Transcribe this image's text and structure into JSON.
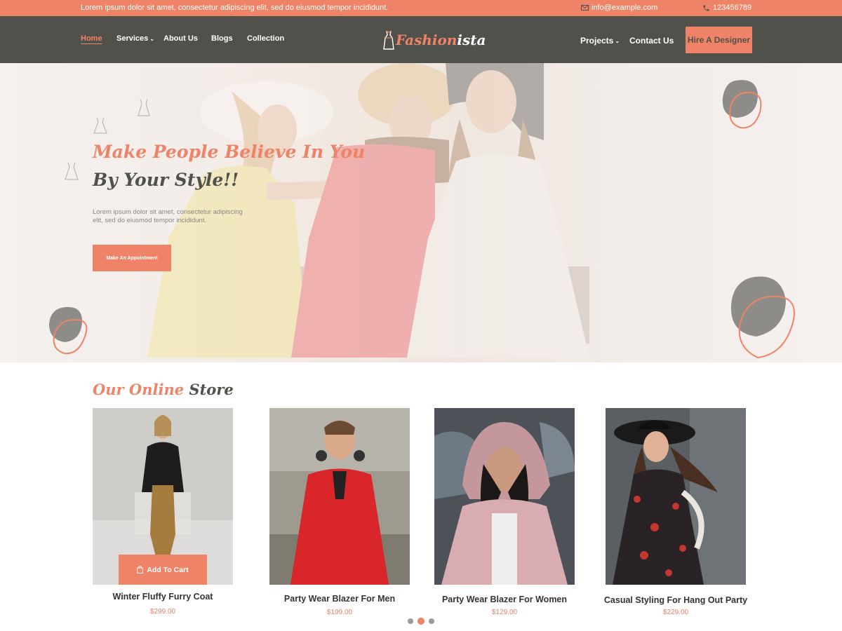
{
  "topbar": {
    "promo": "Lorem ipsum dolor sit amet, consectetur adipiscing elit, sed do eiusmod tempor incididunt.",
    "email": "info@example.com",
    "phone": "123456789"
  },
  "nav": {
    "home": "Home",
    "services": "Services",
    "about": "About Us",
    "blogs": "Blogs",
    "collection": "Collection",
    "projects": "Projects",
    "contact": "Contact Us",
    "hire": "Hire A Designer",
    "caret": "⌄"
  },
  "logo": {
    "part1": "Fashion",
    "part2": "ista"
  },
  "hero": {
    "line1": "Make People Believe In You",
    "line2": "By Your Style!!",
    "description": "Lorem ipsum dolor sit amet, consectetur adipiscing elit, sed do eiusmod tempor incididunt.",
    "cta": "Make An Appointment"
  },
  "store": {
    "title_part1": "Our Online",
    "title_part2": "Store",
    "add_to_cart": "Add To Cart",
    "products": [
      {
        "name": "Winter Fluffy Furry Coat",
        "price": "$299.00"
      },
      {
        "name": "Party Wear Blazer For Men",
        "price": "$199.00"
      },
      {
        "name": "Party Wear Blazer For Women",
        "price": "$129.00"
      },
      {
        "name": "Casual Styling For Hang Out Party",
        "price": "$229.00"
      }
    ]
  },
  "colors": {
    "accent": "#ee8367",
    "dark": "#50514b"
  },
  "icons": {
    "email": "envelope-icon",
    "phone": "phone-icon",
    "cart": "shopping-bag-icon"
  }
}
